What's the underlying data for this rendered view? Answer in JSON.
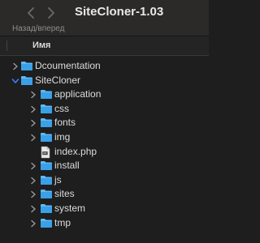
{
  "window": {
    "title": "SiteCloner-1.03",
    "nav_label": "Назад/вперед"
  },
  "list": {
    "column_name": "Имя",
    "rows": [
      {
        "label": "Dcoumentation",
        "kind": "folder",
        "expanded": false,
        "level": 0
      },
      {
        "label": "SiteCloner",
        "kind": "folder",
        "expanded": true,
        "level": 0
      },
      {
        "label": "application",
        "kind": "folder",
        "expanded": false,
        "level": 1
      },
      {
        "label": "css",
        "kind": "folder",
        "expanded": false,
        "level": 1
      },
      {
        "label": "fonts",
        "kind": "folder",
        "expanded": false,
        "level": 1
      },
      {
        "label": "img",
        "kind": "folder",
        "expanded": false,
        "level": 1
      },
      {
        "label": "index.php",
        "kind": "file",
        "expanded": false,
        "level": 1
      },
      {
        "label": "install",
        "kind": "folder",
        "expanded": false,
        "level": 1
      },
      {
        "label": "js",
        "kind": "folder",
        "expanded": false,
        "level": 1
      },
      {
        "label": "sites",
        "kind": "folder",
        "expanded": false,
        "level": 1
      },
      {
        "label": "system",
        "kind": "folder",
        "expanded": false,
        "level": 1
      },
      {
        "label": "tmp",
        "kind": "folder",
        "expanded": false,
        "level": 1
      }
    ]
  },
  "colors": {
    "folder": "#3aa0e8",
    "folder_tab": "#63b8f2",
    "expanded_chevron": "#3b82f6",
    "background": "#1e1e1e",
    "toolbar": "#2b2a28"
  },
  "icons": {
    "back": "chevron-left-icon",
    "forward": "chevron-right-icon",
    "folder": "folder-icon",
    "file": "document-icon",
    "disclosure": "disclosure-chevron-icon"
  }
}
